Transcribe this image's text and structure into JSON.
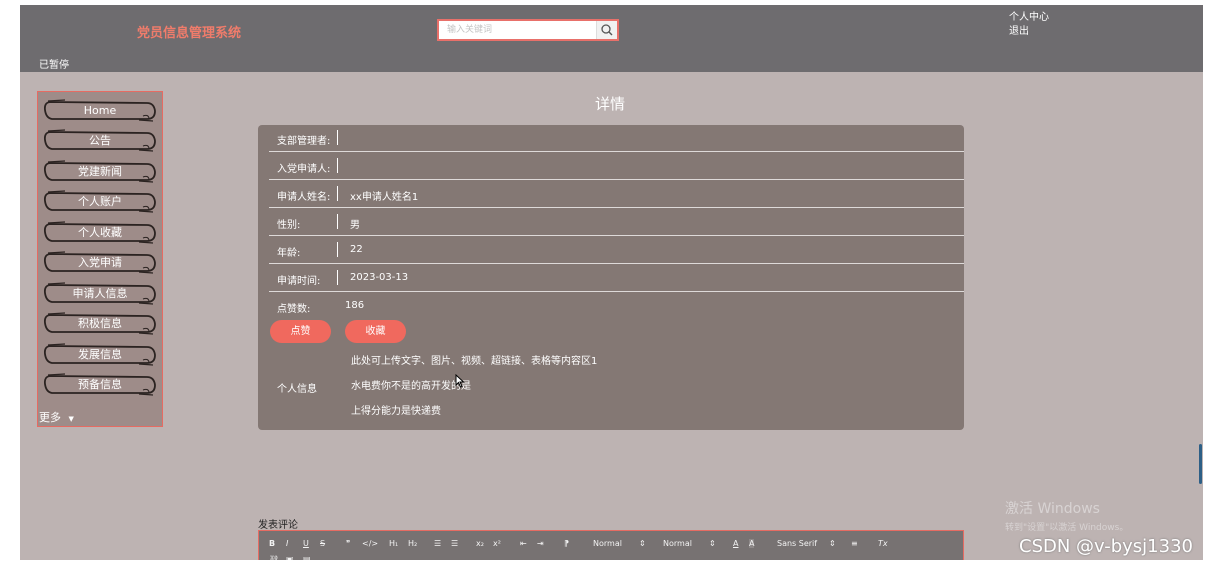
{
  "app": {
    "title": "党员信息管理系统",
    "paused_label": "已暂停"
  },
  "search": {
    "placeholder": "输入关键词"
  },
  "user_menu": {
    "profile": "个人中心",
    "logout": "退出"
  },
  "sidebar": {
    "items": [
      {
        "label": "Home"
      },
      {
        "label": "公告"
      },
      {
        "label": "党建新闻"
      },
      {
        "label": "个人账户"
      },
      {
        "label": "个人收藏"
      },
      {
        "label": "入党申请"
      },
      {
        "label": "申请人信息"
      },
      {
        "label": "积极信息"
      },
      {
        "label": "发展信息"
      },
      {
        "label": "预备信息"
      }
    ],
    "more": "更多"
  },
  "detail": {
    "title": "详情",
    "fields": [
      {
        "label": "支部管理者:",
        "value": ""
      },
      {
        "label": "入党申请人:",
        "value": ""
      },
      {
        "label": "申请人姓名:",
        "value": "xx申请人姓名1"
      },
      {
        "label": "性别:",
        "value": "男"
      },
      {
        "label": "年龄:",
        "value": "22"
      },
      {
        "label": "申请时间:",
        "value": "2023-03-13"
      }
    ],
    "likes_label": "点赞数:",
    "likes_value": "186",
    "like_button": "点赞",
    "favorite_button": "收藏",
    "info_label": "个人信息",
    "info_lines": [
      "此处可上传文字、图片、视频、超链接、表格等内容区1",
      "水电费你不是的高开发的是",
      "上得分能力是快递费"
    ]
  },
  "comment": {
    "label": "发表评论",
    "toolbar": {
      "bold": "B",
      "italic": "I",
      "underline": "U",
      "strike": "S",
      "quote": "❞",
      "code": "</>",
      "h1": "H₁",
      "h2": "H₂",
      "ordered_list": "☰",
      "bullet_list": "☰",
      "subscript": "x₂",
      "superscript": "x²",
      "outdent": "⇤",
      "indent": "⇥",
      "rtl": "⁋",
      "size_select": "Normal",
      "header_select": "Normal",
      "color": "A",
      "background": "A",
      "font_select": "Sans Serif",
      "align": "≡",
      "clean": "Tx"
    }
  },
  "os_watermark": {
    "line1": "激活 Windows",
    "line2": "转到\"设置\"以激活 Windows。"
  },
  "credit": "CSDN @v-bysj1330",
  "colors": {
    "topbar": "#6e6c6f",
    "page": "#bdb3b2",
    "panel": "#847874",
    "accent": "#f0695e",
    "title": "#f07c6b"
  }
}
